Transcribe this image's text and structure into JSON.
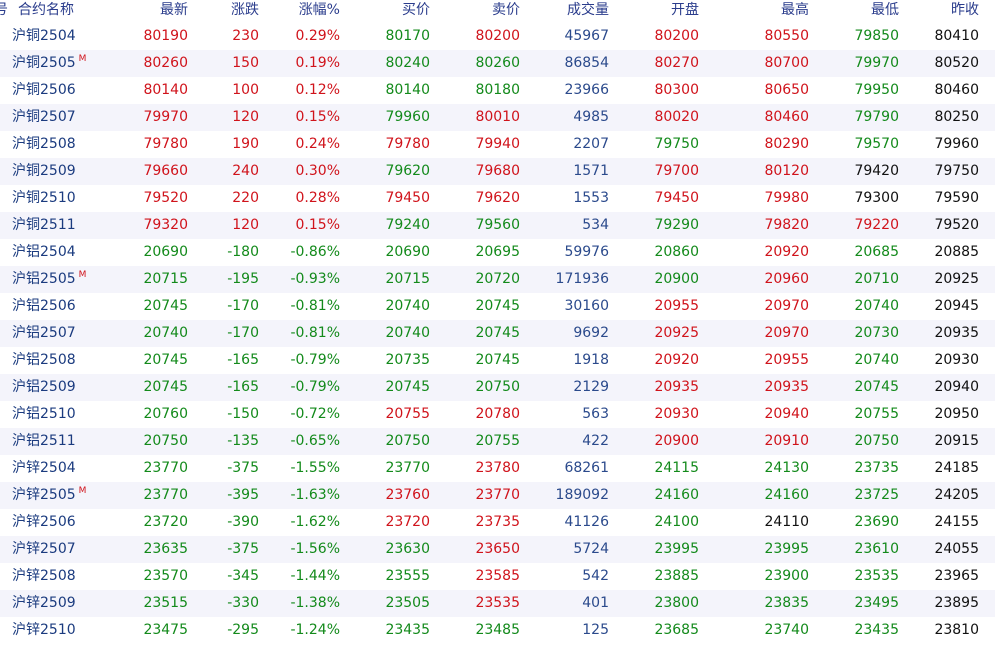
{
  "header": {
    "marker": "号",
    "name": "合约名称",
    "last": "最新",
    "change": "涨跌",
    "change_pct": "涨幅%",
    "bid": "买价",
    "ask": "卖价",
    "volume": "成交量",
    "open": "开盘",
    "high": "最高",
    "low": "最低",
    "prev_close": "昨收"
  },
  "colors": {
    "up": "#d0131b",
    "down": "#138a1b",
    "flat": "#111111",
    "volume": "#2b4a8c",
    "name": "#1b3b7f",
    "header_text": "#2a3c8c",
    "row_alt_bg": "#f4f4fb"
  },
  "rows": [
    {
      "name": "沪铜2504",
      "marker": "",
      "last": "80190",
      "change": "230",
      "change_pct": "0.29%",
      "bid": "80170",
      "ask": "80200",
      "volume": "45967",
      "open": "80200",
      "high": "80550",
      "low": "79850",
      "prev_close": "80410",
      "c": {
        "last": "up",
        "change": "up",
        "change_pct": "up",
        "bid": "down",
        "ask": "up",
        "open": "up",
        "high": "up",
        "low": "down"
      }
    },
    {
      "name": "沪铜2505",
      "marker": "M",
      "last": "80260",
      "change": "150",
      "change_pct": "0.19%",
      "bid": "80240",
      "ask": "80260",
      "volume": "86854",
      "open": "80270",
      "high": "80700",
      "low": "79970",
      "prev_close": "80520",
      "c": {
        "last": "up",
        "change": "up",
        "change_pct": "up",
        "bid": "down",
        "ask": "down",
        "open": "up",
        "high": "up",
        "low": "down"
      }
    },
    {
      "name": "沪铜2506",
      "marker": "",
      "last": "80140",
      "change": "100",
      "change_pct": "0.12%",
      "bid": "80140",
      "ask": "80180",
      "volume": "23966",
      "open": "80300",
      "high": "80650",
      "low": "79950",
      "prev_close": "80460",
      "c": {
        "last": "up",
        "change": "up",
        "change_pct": "up",
        "bid": "down",
        "ask": "down",
        "open": "up",
        "high": "up",
        "low": "down"
      }
    },
    {
      "name": "沪铜2507",
      "marker": "",
      "last": "79970",
      "change": "120",
      "change_pct": "0.15%",
      "bid": "79960",
      "ask": "80010",
      "volume": "4985",
      "open": "80020",
      "high": "80460",
      "low": "79790",
      "prev_close": "80250",
      "c": {
        "last": "up",
        "change": "up",
        "change_pct": "up",
        "bid": "down",
        "ask": "up",
        "open": "up",
        "high": "up",
        "low": "down"
      }
    },
    {
      "name": "沪铜2508",
      "marker": "",
      "last": "79780",
      "change": "190",
      "change_pct": "0.24%",
      "bid": "79780",
      "ask": "79940",
      "volume": "2207",
      "open": "79750",
      "high": "80290",
      "low": "79570",
      "prev_close": "79960",
      "c": {
        "last": "up",
        "change": "up",
        "change_pct": "up",
        "bid": "up",
        "ask": "up",
        "open": "down",
        "high": "up",
        "low": "down"
      }
    },
    {
      "name": "沪铜2509",
      "marker": "",
      "last": "79660",
      "change": "240",
      "change_pct": "0.30%",
      "bid": "79620",
      "ask": "79680",
      "volume": "1571",
      "open": "79700",
      "high": "80120",
      "low": "79420",
      "prev_close": "79750",
      "c": {
        "last": "up",
        "change": "up",
        "change_pct": "up",
        "bid": "down",
        "ask": "up",
        "open": "up",
        "high": "up",
        "low": "flat"
      }
    },
    {
      "name": "沪铜2510",
      "marker": "",
      "last": "79520",
      "change": "220",
      "change_pct": "0.28%",
      "bid": "79450",
      "ask": "79620",
      "volume": "1553",
      "open": "79450",
      "high": "79980",
      "low": "79300",
      "prev_close": "79590",
      "c": {
        "last": "up",
        "change": "up",
        "change_pct": "up",
        "bid": "up",
        "ask": "up",
        "open": "up",
        "high": "up",
        "low": "flat"
      }
    },
    {
      "name": "沪铜2511",
      "marker": "",
      "last": "79320",
      "change": "120",
      "change_pct": "0.15%",
      "bid": "79240",
      "ask": "79560",
      "volume": "534",
      "open": "79290",
      "high": "79820",
      "low": "79220",
      "prev_close": "79520",
      "c": {
        "last": "up",
        "change": "up",
        "change_pct": "up",
        "bid": "down",
        "ask": "down",
        "open": "down",
        "high": "up",
        "low": "up"
      }
    },
    {
      "name": "沪铝2504",
      "marker": "",
      "last": "20690",
      "change": "-180",
      "change_pct": "-0.86%",
      "bid": "20690",
      "ask": "20695",
      "volume": "59976",
      "open": "20860",
      "high": "20920",
      "low": "20685",
      "prev_close": "20885",
      "c": {
        "last": "down",
        "change": "down",
        "change_pct": "down",
        "bid": "down",
        "ask": "down",
        "open": "down",
        "high": "up",
        "low": "down"
      }
    },
    {
      "name": "沪铝2505",
      "marker": "M",
      "last": "20715",
      "change": "-195",
      "change_pct": "-0.93%",
      "bid": "20715",
      "ask": "20720",
      "volume": "171936",
      "open": "20900",
      "high": "20960",
      "low": "20710",
      "prev_close": "20925",
      "c": {
        "last": "down",
        "change": "down",
        "change_pct": "down",
        "bid": "down",
        "ask": "down",
        "open": "down",
        "high": "up",
        "low": "down"
      }
    },
    {
      "name": "沪铝2506",
      "marker": "",
      "last": "20745",
      "change": "-170",
      "change_pct": "-0.81%",
      "bid": "20740",
      "ask": "20745",
      "volume": "30160",
      "open": "20955",
      "high": "20970",
      "low": "20740",
      "prev_close": "20945",
      "c": {
        "last": "down",
        "change": "down",
        "change_pct": "down",
        "bid": "down",
        "ask": "down",
        "open": "up",
        "high": "up",
        "low": "down"
      }
    },
    {
      "name": "沪铝2507",
      "marker": "",
      "last": "20740",
      "change": "-170",
      "change_pct": "-0.81%",
      "bid": "20740",
      "ask": "20745",
      "volume": "9692",
      "open": "20925",
      "high": "20970",
      "low": "20730",
      "prev_close": "20935",
      "c": {
        "last": "down",
        "change": "down",
        "change_pct": "down",
        "bid": "down",
        "ask": "down",
        "open": "up",
        "high": "up",
        "low": "down"
      }
    },
    {
      "name": "沪铝2508",
      "marker": "",
      "last": "20745",
      "change": "-165",
      "change_pct": "-0.79%",
      "bid": "20735",
      "ask": "20745",
      "volume": "1918",
      "open": "20920",
      "high": "20955",
      "low": "20740",
      "prev_close": "20930",
      "c": {
        "last": "down",
        "change": "down",
        "change_pct": "down",
        "bid": "down",
        "ask": "down",
        "open": "up",
        "high": "up",
        "low": "down"
      }
    },
    {
      "name": "沪铝2509",
      "marker": "",
      "last": "20745",
      "change": "-165",
      "change_pct": "-0.79%",
      "bid": "20745",
      "ask": "20750",
      "volume": "2129",
      "open": "20935",
      "high": "20935",
      "low": "20745",
      "prev_close": "20940",
      "c": {
        "last": "down",
        "change": "down",
        "change_pct": "down",
        "bid": "down",
        "ask": "down",
        "open": "up",
        "high": "up",
        "low": "down"
      }
    },
    {
      "name": "沪铝2510",
      "marker": "",
      "last": "20760",
      "change": "-150",
      "change_pct": "-0.72%",
      "bid": "20755",
      "ask": "20780",
      "volume": "563",
      "open": "20930",
      "high": "20940",
      "low": "20755",
      "prev_close": "20950",
      "c": {
        "last": "down",
        "change": "down",
        "change_pct": "down",
        "bid": "up",
        "ask": "up",
        "open": "up",
        "high": "up",
        "low": "down"
      }
    },
    {
      "name": "沪铝2511",
      "marker": "",
      "last": "20750",
      "change": "-135",
      "change_pct": "-0.65%",
      "bid": "20750",
      "ask": "20755",
      "volume": "422",
      "open": "20900",
      "high": "20910",
      "low": "20750",
      "prev_close": "20915",
      "c": {
        "last": "down",
        "change": "down",
        "change_pct": "down",
        "bid": "down",
        "ask": "down",
        "open": "up",
        "high": "up",
        "low": "down"
      }
    },
    {
      "name": "沪锌2504",
      "marker": "",
      "last": "23770",
      "change": "-375",
      "change_pct": "-1.55%",
      "bid": "23770",
      "ask": "23780",
      "volume": "68261",
      "open": "24115",
      "high": "24130",
      "low": "23735",
      "prev_close": "24185",
      "c": {
        "last": "down",
        "change": "down",
        "change_pct": "down",
        "bid": "down",
        "ask": "up",
        "open": "down",
        "high": "down",
        "low": "down"
      }
    },
    {
      "name": "沪锌2505",
      "marker": "M",
      "last": "23770",
      "change": "-395",
      "change_pct": "-1.63%",
      "bid": "23760",
      "ask": "23770",
      "volume": "189092",
      "open": "24160",
      "high": "24160",
      "low": "23725",
      "prev_close": "24205",
      "c": {
        "last": "down",
        "change": "down",
        "change_pct": "down",
        "bid": "up",
        "ask": "up",
        "open": "down",
        "high": "down",
        "low": "down"
      }
    },
    {
      "name": "沪锌2506",
      "marker": "",
      "last": "23720",
      "change": "-390",
      "change_pct": "-1.62%",
      "bid": "23720",
      "ask": "23735",
      "volume": "41126",
      "open": "24100",
      "high": "24110",
      "low": "23690",
      "prev_close": "24155",
      "c": {
        "last": "down",
        "change": "down",
        "change_pct": "down",
        "bid": "up",
        "ask": "up",
        "open": "down",
        "high": "flat",
        "low": "down"
      }
    },
    {
      "name": "沪锌2507",
      "marker": "",
      "last": "23635",
      "change": "-375",
      "change_pct": "-1.56%",
      "bid": "23630",
      "ask": "23650",
      "volume": "5724",
      "open": "23995",
      "high": "23995",
      "low": "23610",
      "prev_close": "24055",
      "c": {
        "last": "down",
        "change": "down",
        "change_pct": "down",
        "bid": "down",
        "ask": "up",
        "open": "down",
        "high": "down",
        "low": "down"
      }
    },
    {
      "name": "沪锌2508",
      "marker": "",
      "last": "23570",
      "change": "-345",
      "change_pct": "-1.44%",
      "bid": "23555",
      "ask": "23585",
      "volume": "542",
      "open": "23885",
      "high": "23900",
      "low": "23535",
      "prev_close": "23965",
      "c": {
        "last": "down",
        "change": "down",
        "change_pct": "down",
        "bid": "down",
        "ask": "up",
        "open": "down",
        "high": "down",
        "low": "down"
      }
    },
    {
      "name": "沪锌2509",
      "marker": "",
      "last": "23515",
      "change": "-330",
      "change_pct": "-1.38%",
      "bid": "23505",
      "ask": "23535",
      "volume": "401",
      "open": "23800",
      "high": "23835",
      "low": "23495",
      "prev_close": "23895",
      "c": {
        "last": "down",
        "change": "down",
        "change_pct": "down",
        "bid": "down",
        "ask": "up",
        "open": "down",
        "high": "down",
        "low": "down"
      }
    },
    {
      "name": "沪锌2510",
      "marker": "",
      "last": "23475",
      "change": "-295",
      "change_pct": "-1.24%",
      "bid": "23435",
      "ask": "23485",
      "volume": "125",
      "open": "23685",
      "high": "23740",
      "low": "23435",
      "prev_close": "23810",
      "c": {
        "last": "down",
        "change": "down",
        "change_pct": "down",
        "bid": "down",
        "ask": "down",
        "open": "down",
        "high": "down",
        "low": "down"
      }
    }
  ]
}
